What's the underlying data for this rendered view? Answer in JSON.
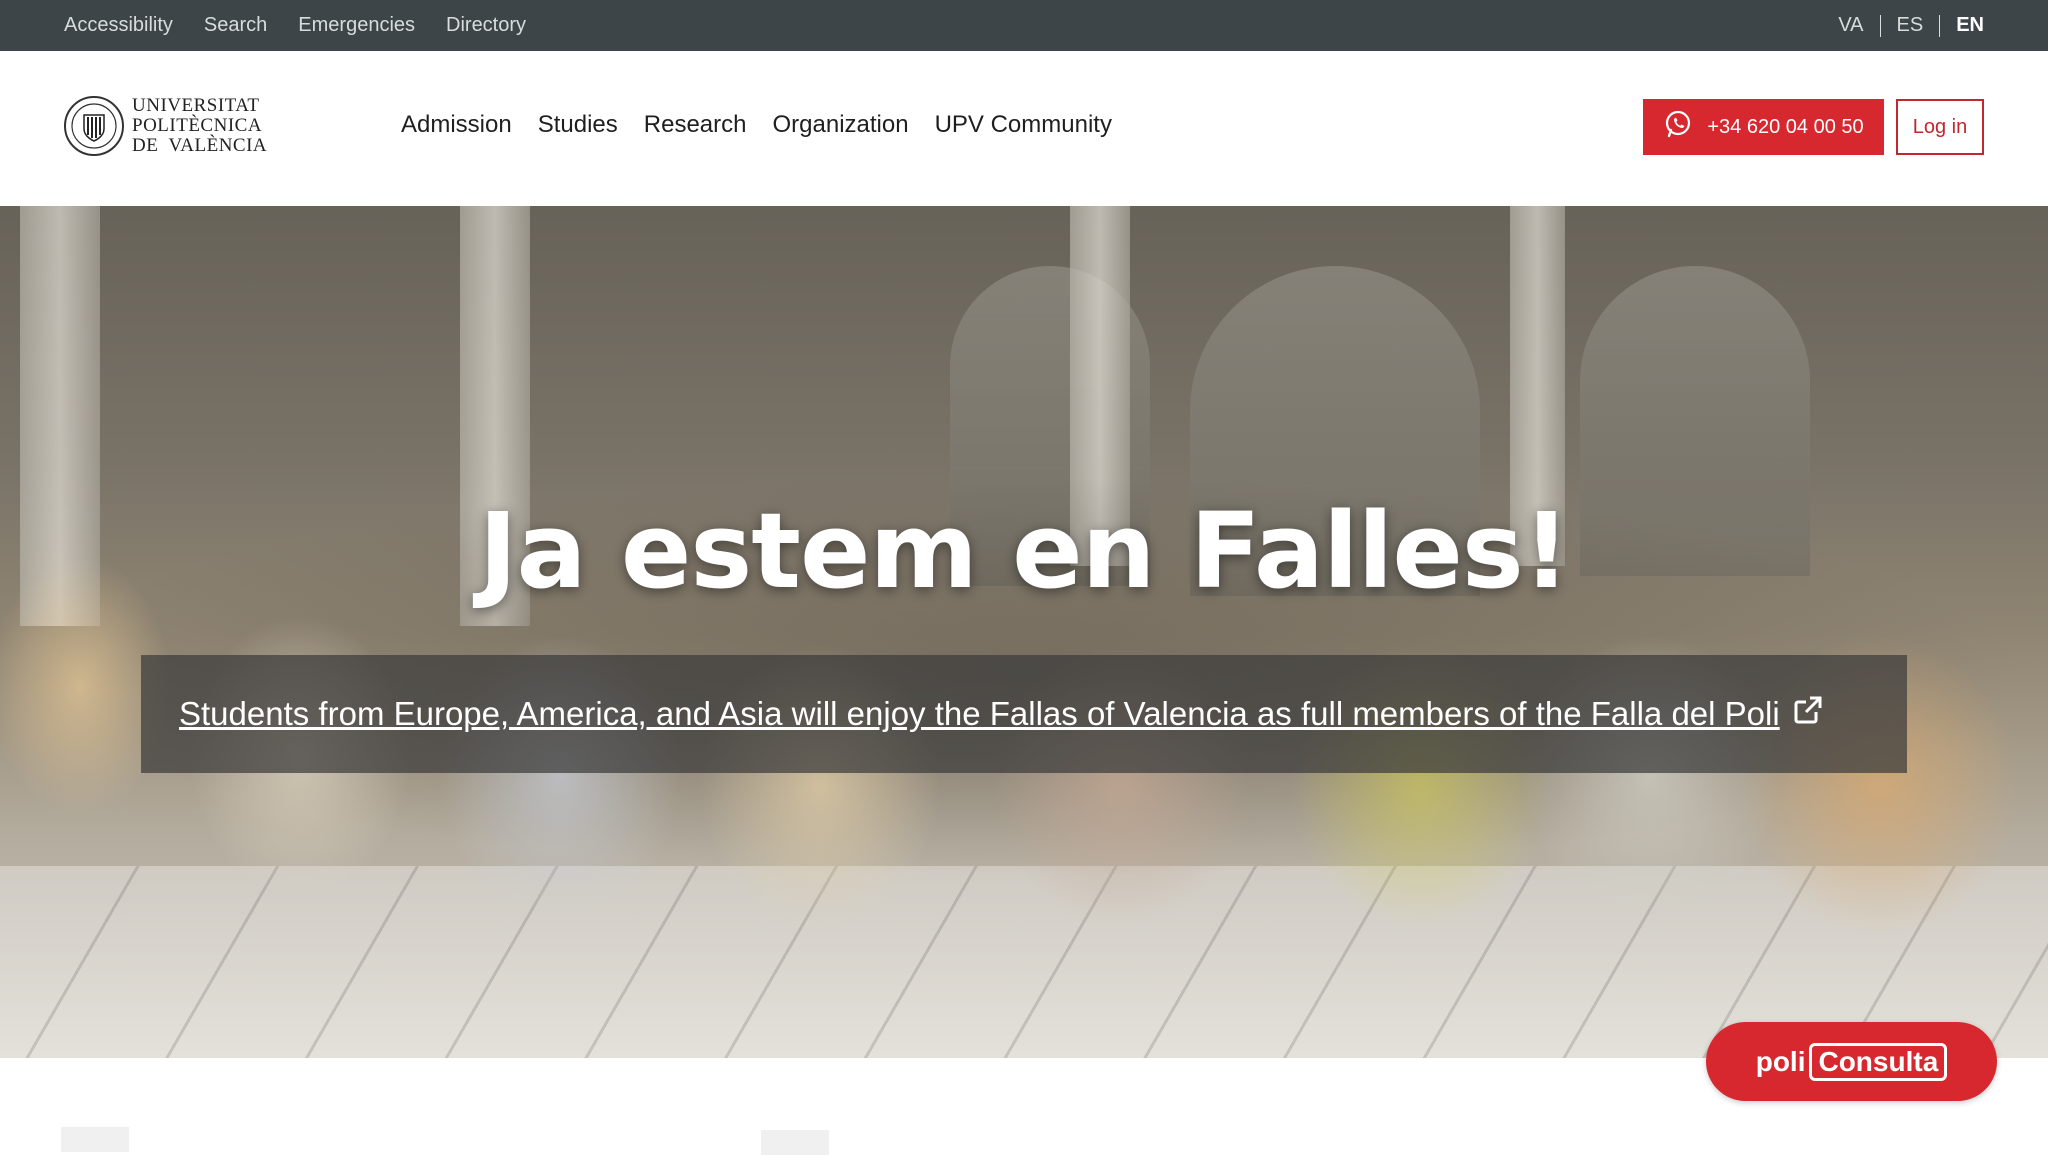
{
  "topbar": {
    "links": [
      "Accessibility",
      "Search",
      "Emergencies",
      "Directory"
    ],
    "languages": [
      {
        "code": "VA",
        "active": false
      },
      {
        "code": "ES",
        "active": false
      },
      {
        "code": "EN",
        "active": true
      }
    ]
  },
  "header": {
    "logo_lines": [
      "UNIVERSITAT",
      "POLITÈCNICA",
      "DE  VALÈNCIA"
    ],
    "nav": [
      "Admission",
      "Studies",
      "Research",
      "Organization",
      "UPV Community"
    ],
    "whatsapp_label": "+34 620 04 00 50",
    "login_label": "Log in"
  },
  "hero": {
    "title": "Ja estem en Falles!",
    "caption": "Students from Europe, America, and Asia will enjoy the Fallas of Valencia as full members of the Falla del Poli"
  },
  "floating": {
    "poli_label": "poli",
    "consulta_label": "Consulta"
  },
  "colors": {
    "topbar_bg": "#3d4548",
    "accent_red": "#d7282f",
    "login_border": "#c1272d"
  },
  "icons": {
    "whatsapp": "whatsapp-icon",
    "external_link": "external-link-icon",
    "seal": "upv-seal-icon"
  }
}
